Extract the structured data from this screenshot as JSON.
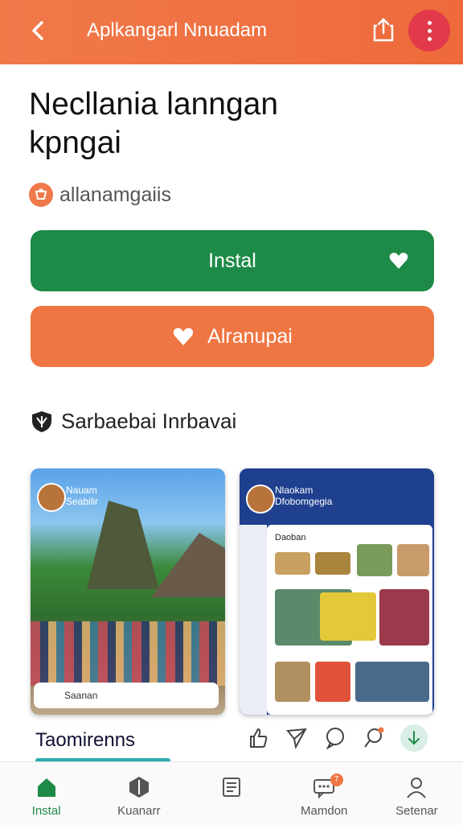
{
  "header": {
    "title": "Aplkangarl Nnuadam",
    "back_icon": "back-arrow-icon",
    "share_icon": "share-icon",
    "menu_icon": "more-vertical-icon"
  },
  "app": {
    "title_line1": "Necllania lanngan",
    "title_line2": "kpngai",
    "developer": "allanamgaiis"
  },
  "buttons": {
    "install_label": "Instal",
    "wishlist_label": "Alranupai"
  },
  "section": {
    "title": "Sarbaebai Inrbavai"
  },
  "screenshots": {
    "shot1_caption_line1": "Nauam",
    "shot1_caption_line2": "Seabilir",
    "shot1_search": "Saanan",
    "shot2_caption_line1": "Nlaokam",
    "shot2_caption_line2": "Dfobomgegia",
    "shot2_chip": "Daoban"
  },
  "meta": {
    "title": "Taomirenns"
  },
  "bottom_nav": [
    {
      "label": "Instal",
      "icon": "store-icon",
      "active": true
    },
    {
      "label": "Kuanarr",
      "icon": "games-icon",
      "active": false
    },
    {
      "label": "",
      "icon": "book-icon",
      "active": false
    },
    {
      "label": "Mamdon",
      "icon": "chat-icon",
      "active": false,
      "badge": "7"
    },
    {
      "label": "Setenar",
      "icon": "profile-icon",
      "active": false
    }
  ],
  "colors": {
    "header": "#ef6e3f",
    "install": "#1e8a47",
    "wishlist": "#ef7642",
    "accent": "#2aaab0"
  }
}
